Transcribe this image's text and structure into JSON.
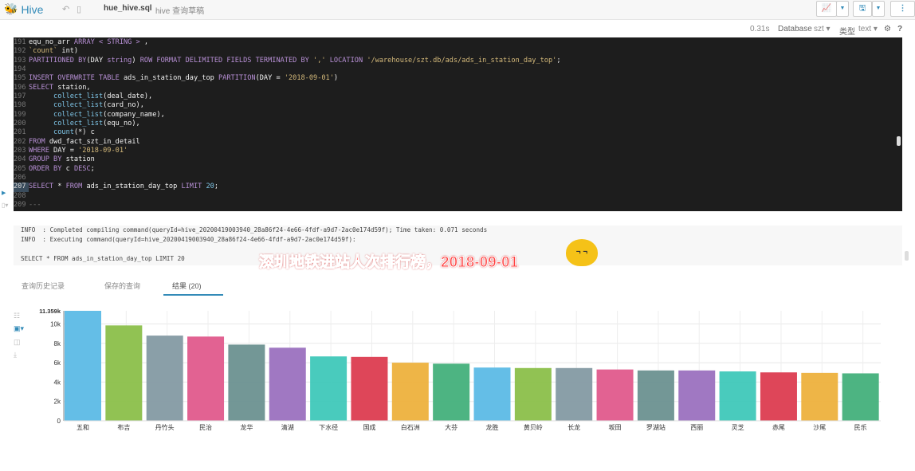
{
  "header": {
    "app": "Hive",
    "file": "hue_hive.sql",
    "draft": "hive 查询草稿"
  },
  "toolbar": {
    "time": "0.31s",
    "database_label": "Database",
    "database": "szt",
    "type_label": "类型",
    "type": "text",
    "help": "?"
  },
  "icons": [
    "hive-logo-icon",
    "undo-icon",
    "new-file-icon",
    "chart-icon",
    "save-icon",
    "more-icon",
    "gear-icon"
  ],
  "editor": {
    "lines": [
      {
        "no": "191",
        "tokens": [
          [
            "",
            "equ_no_arr "
          ],
          [
            "k",
            "ARRAY < STRING > "
          ],
          [
            "",
            ","
          ]
        ]
      },
      {
        "no": "192",
        "tokens": [
          [
            "s",
            "`count`"
          ],
          [
            "",
            " int)"
          ]
        ]
      },
      {
        "no": "193",
        "tokens": [
          [
            "k",
            "PARTITIONED BY"
          ],
          [
            "",
            "(DAY "
          ],
          [
            "k",
            "string"
          ],
          [
            "",
            ") "
          ],
          [
            "k",
            "ROW FORMAT DELIMITED FIELDS TERMINATED BY "
          ],
          [
            "s",
            "','"
          ],
          [
            "k",
            " LOCATION "
          ],
          [
            "s",
            "'/warehouse/szt.db/ads/ads_in_station_day_top'"
          ],
          [
            "",
            ";"
          ]
        ]
      },
      {
        "no": "194",
        "tokens": []
      },
      {
        "no": "195",
        "tokens": [
          [
            "k",
            "INSERT OVERWRITE TABLE "
          ],
          [
            "",
            "ads_in_station_day_top "
          ],
          [
            "k",
            "PARTITION"
          ],
          [
            "",
            "(DAY = "
          ],
          [
            "s",
            "'2018-09-01'"
          ],
          [
            "",
            ")"
          ]
        ]
      },
      {
        "no": "196",
        "tokens": [
          [
            "k",
            "SELECT "
          ],
          [
            "",
            "station,"
          ]
        ]
      },
      {
        "no": "197",
        "tokens": [
          [
            "",
            "      "
          ],
          [
            "f",
            "collect_list"
          ],
          [
            "",
            "(deal_date),"
          ]
        ]
      },
      {
        "no": "198",
        "tokens": [
          [
            "",
            "      "
          ],
          [
            "f",
            "collect_list"
          ],
          [
            "",
            "(card_no),"
          ]
        ]
      },
      {
        "no": "199",
        "tokens": [
          [
            "",
            "      "
          ],
          [
            "f",
            "collect_list"
          ],
          [
            "",
            "(company_name),"
          ]
        ]
      },
      {
        "no": "200",
        "tokens": [
          [
            "",
            "      "
          ],
          [
            "f",
            "collect_list"
          ],
          [
            "",
            "(equ_no),"
          ]
        ]
      },
      {
        "no": "201",
        "tokens": [
          [
            "",
            "      "
          ],
          [
            "f",
            "count"
          ],
          [
            "",
            "(*) c"
          ]
        ]
      },
      {
        "no": "202",
        "tokens": [
          [
            "k",
            "FROM "
          ],
          [
            "",
            "dwd_fact_szt_in_detail"
          ]
        ]
      },
      {
        "no": "203",
        "tokens": [
          [
            "k",
            "WHERE "
          ],
          [
            "",
            "DAY = "
          ],
          [
            "s",
            "'2018-09-01'"
          ]
        ]
      },
      {
        "no": "204",
        "tokens": [
          [
            "k",
            "GROUP BY "
          ],
          [
            "",
            "station"
          ]
        ]
      },
      {
        "no": "205",
        "tokens": [
          [
            "k",
            "ORDER BY "
          ],
          [
            "",
            "c "
          ],
          [
            "k",
            "DESC"
          ],
          [
            "",
            ";"
          ]
        ]
      },
      {
        "no": "206",
        "tokens": []
      },
      {
        "no": "207",
        "tokens": [
          [
            "k",
            "SELECT "
          ],
          [
            "",
            "* "
          ],
          [
            "k",
            "FROM "
          ],
          [
            "",
            "ads_in_station_day_top "
          ],
          [
            "k",
            "LIMIT "
          ],
          [
            "n",
            "20"
          ],
          [
            "",
            ";"
          ]
        ],
        "current": true
      },
      {
        "no": "208",
        "tokens": []
      },
      {
        "no": "209",
        "tokens": [
          [
            "c",
            "---"
          ]
        ]
      }
    ]
  },
  "log": [
    "INFO  : Completed compiling command(queryId=hive_20200419003940_28a86f24-4e66-4fdf-a9d7-2ac0e174d59f); Time taken: 0.071 seconds",
    "INFO  : Executing command(queryId=hive_20200419003940_28a86f24-4e66-4fdf-a9d7-2ac0e174d59f):",
    "",
    "SELECT * FROM ads_in_station_day_top LIMIT 20"
  ],
  "overlay": {
    "caption": "深圳地铁进站人次排行榜，2018-09-01",
    "emoji": "smirk-emoji"
  },
  "tabs": [
    {
      "label": "查询历史记录"
    },
    {
      "label": "保存的查询"
    },
    {
      "label": "结果 (20)",
      "active": true
    }
  ],
  "chart_data": {
    "type": "bar",
    "categories": [
      "五和",
      "布吉",
      "丹竹头",
      "民治",
      "龙华",
      "清湖",
      "下水径",
      "国成",
      "白石洲",
      "大芬",
      "龙胜",
      "黄贝岭",
      "长龙",
      "坂田",
      "罗湖站",
      "西丽",
      "灵芝",
      "赤尾",
      "沙尾",
      "民乐"
    ],
    "values": [
      11359,
      9850,
      8800,
      8700,
      7870,
      7550,
      6650,
      6600,
      6000,
      5900,
      5500,
      5450,
      5450,
      5300,
      5200,
      5200,
      5100,
      5000,
      4950,
      4900
    ],
    "ylim": [
      0,
      11359
    ],
    "yticks": [
      "0",
      "2k",
      "4k",
      "6k",
      "8k",
      "10k",
      "11.359k"
    ],
    "grid": true,
    "colors": [
      "#5cbae6",
      "#8bbf4a",
      "#849aa3",
      "#e05a8c",
      "#6b9190",
      "#9b71bf",
      "#3fc8b9",
      "#dc3c50",
      "#edb13d",
      "#43b07b"
    ]
  }
}
